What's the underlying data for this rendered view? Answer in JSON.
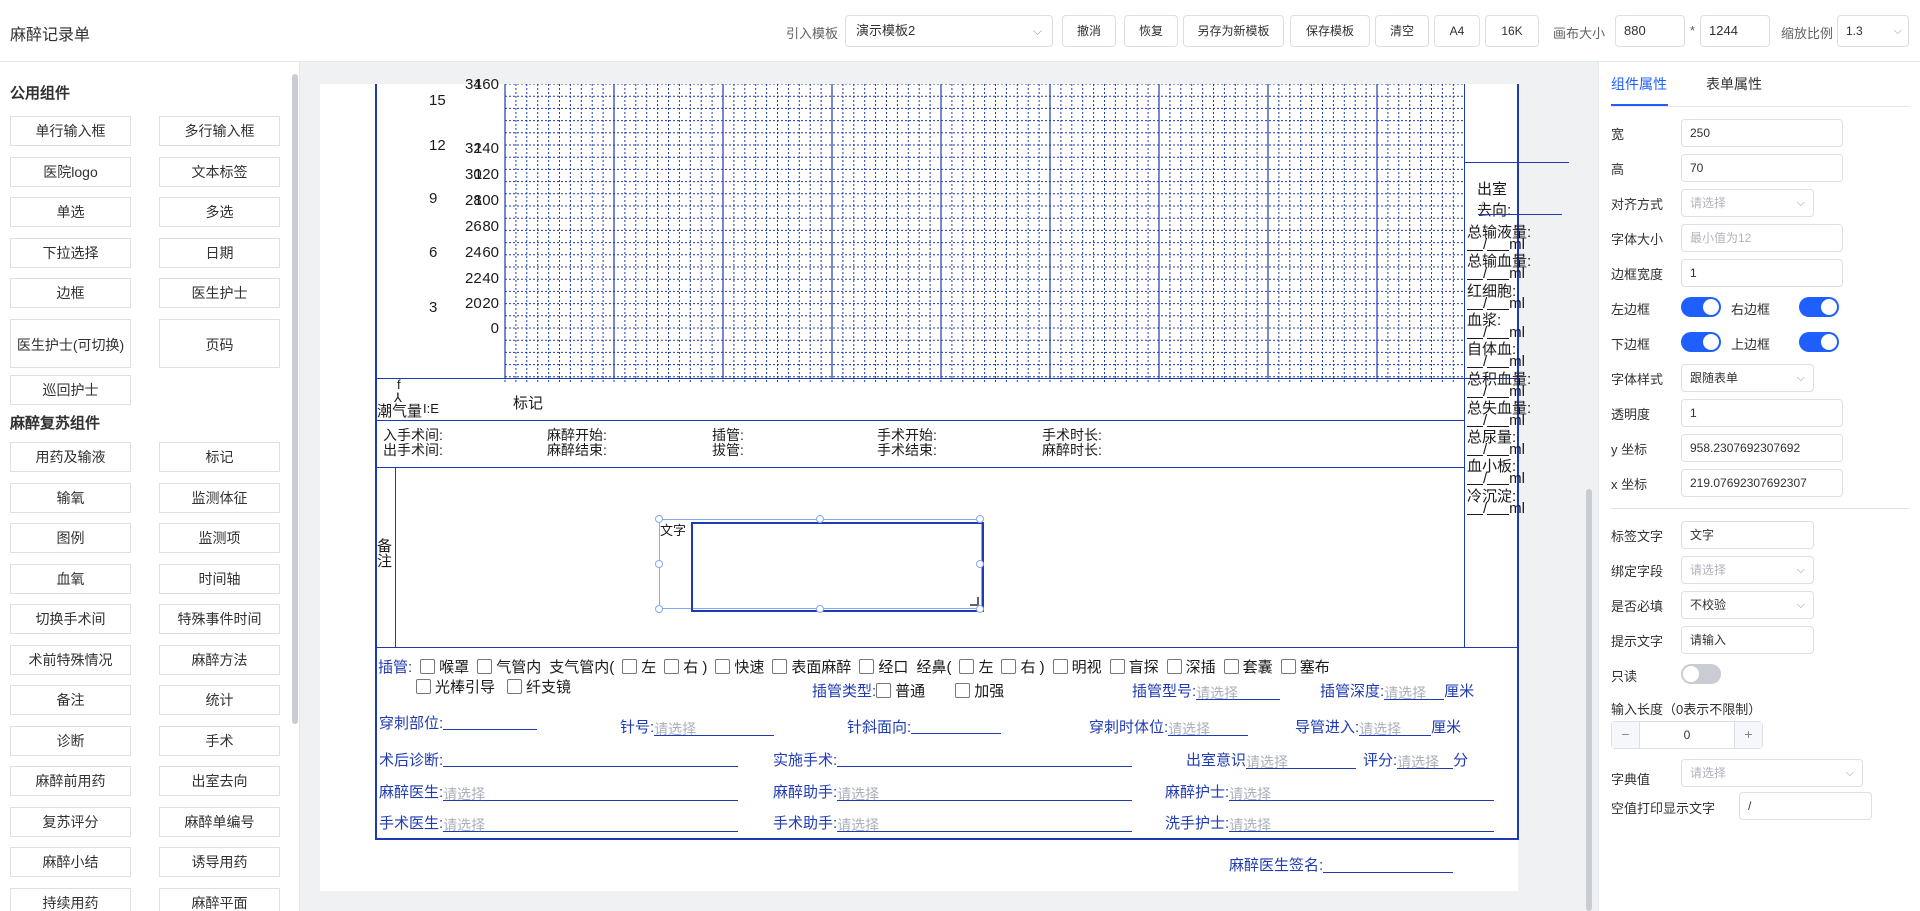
{
  "header": {
    "app_title": "麻醉记录单",
    "template_label": "引入模板",
    "template_value": "演示模板2",
    "buttons": {
      "undo": "撤消",
      "redo": "恢复",
      "save_as_new": "另存为新模板",
      "save": "保存模板",
      "clear": "清空",
      "a4": "A4",
      "k16": "16K"
    },
    "canvas_size_label": "画布大小",
    "canvas_width": "880",
    "canvas_times": "*",
    "canvas_height": "1244",
    "zoom_label": "缩放比例",
    "zoom_value": "1.3"
  },
  "sidebar": {
    "public_title": "公用组件",
    "public_items": [
      "单行输入框",
      "多行输入框",
      "医院logo",
      "文本标签",
      "单选",
      "多选",
      "下拉选择",
      "日期",
      "边框",
      "医生护士",
      "医生护士(可切换)",
      "页码",
      "巡回护士"
    ],
    "anes_title": "麻醉复苏组件",
    "anes_items": [
      "用药及输液",
      "标记",
      "输氧",
      "监测体征",
      "图例",
      "监测项",
      "血氧",
      "时间轴",
      "切换手术间",
      "特殊事件时间",
      "术前特殊情况",
      "麻醉方法",
      "备注",
      "统计",
      "诊断",
      "手术",
      "麻醉前用药",
      "出室去向",
      "复苏评分",
      "麻醉单编号",
      "麻醉小结",
      "诱导用药",
      "持续用药",
      "麻醉平面"
    ]
  },
  "form": {
    "axis_col1": [
      "15",
      "12",
      "9",
      "6",
      "3"
    ],
    "axis_col2": [
      "34",
      "32",
      "30",
      "28",
      "26",
      "24",
      "22",
      "20"
    ],
    "axis_col3": [
      "160",
      "140",
      "120",
      "100",
      "80",
      "60",
      "40",
      "20",
      "0"
    ],
    "tidal_label": "潮气量",
    "f_label": "f",
    "ie_label": "I:E",
    "mark_label": "标记",
    "right_stats": {
      "out_direction": "出室去向:",
      "out_value": "/",
      "items": [
        "总输液量:",
        "总输血量:",
        "红细胞:",
        "血浆:",
        "自体血:",
        "总积血量:",
        "总失血量:",
        "总尿量:",
        "血小板:",
        "冷沉淀:"
      ],
      "unit_row": "/",
      "unit": "ml"
    },
    "times": [
      [
        "入手术间:",
        "出手术间:"
      ],
      [
        "麻醉开始:",
        "麻醉结束:"
      ],
      [
        "插管:",
        "拔管:"
      ],
      [
        "手术开始:",
        "手术结束:"
      ],
      [
        "手术时长:",
        "麻醉时长:"
      ]
    ],
    "remark_label": "备注",
    "text_widget_label": "文字",
    "intubation": {
      "label": "插管:",
      "row1": [
        "喉罩",
        "气管内",
        "支气管内(",
        "左",
        "右 )",
        "快速",
        "表面麻醉",
        "经口",
        "经鼻(",
        "左",
        "右 )",
        "明视",
        "盲探",
        "深插",
        "套囊",
        "塞布"
      ],
      "row2": [
        "光棒引导",
        "纤支镜"
      ],
      "type_label": "插管类型:",
      "type_options": [
        "普通",
        "加强"
      ],
      "model_label": "插管型号:",
      "depth_label": "插管深度:",
      "depth_unit": "厘米",
      "placeholder": "请选择"
    },
    "puncture": {
      "site": "穿刺部位:",
      "needle": "针号:",
      "bevel": "针斜面向:",
      "position": "穿刺时体位:",
      "catheter": "导管进入:",
      "unit": "厘米"
    },
    "postop": {
      "diagnosis": "术后诊断:",
      "surgery": "实施手术:",
      "consciousness": "出室意识",
      "score": "评分:",
      "score_unit": "分"
    },
    "staff": {
      "anes_doctor": "麻醉医生:",
      "anes_assistant": "麻醉助手:",
      "anes_nurse": "麻醉护士:",
      "surgeon": "手术医生:",
      "surgery_assistant": "手术助手:",
      "scrub_nurse": "洗手护士:"
    },
    "signature": "麻醉医生签名:"
  },
  "panel": {
    "tab_component": "组件属性",
    "tab_form": "表单属性",
    "width_label": "宽",
    "width_value": "250",
    "height_label": "高",
    "height_value": "70",
    "align_label": "对齐方式",
    "align_placeholder": "请选择",
    "font_size_label": "字体大小",
    "font_size_placeholder": "最小值为12",
    "border_width_label": "边框宽度",
    "border_width_value": "1",
    "left_border": "左边框",
    "right_border": "右边框",
    "bottom_border": "下边框",
    "top_border": "上边框",
    "font_style_label": "字体样式",
    "font_style_value": "跟随表单",
    "opacity_label": "透明度",
    "opacity_value": "1",
    "y_label": "y 坐标",
    "y_value": "958.2307692307692",
    "x_label": "x 坐标",
    "x_value": "219.07692307692307",
    "tag_text_label": "标签文字",
    "tag_text_value": "文字",
    "bind_field_label": "绑定字段",
    "bind_field_placeholder": "请选择",
    "required_label": "是否必填",
    "required_value": "不校验",
    "hint_label": "提示文字",
    "hint_value": "请输入",
    "readonly_label": "只读",
    "length_label": "输入长度（0表示不限制）",
    "length_value": "0",
    "dict_label": "字典值",
    "dict_placeholder": "请选择",
    "empty_print_label": "空值打印显示文字",
    "empty_print_value": "/"
  }
}
